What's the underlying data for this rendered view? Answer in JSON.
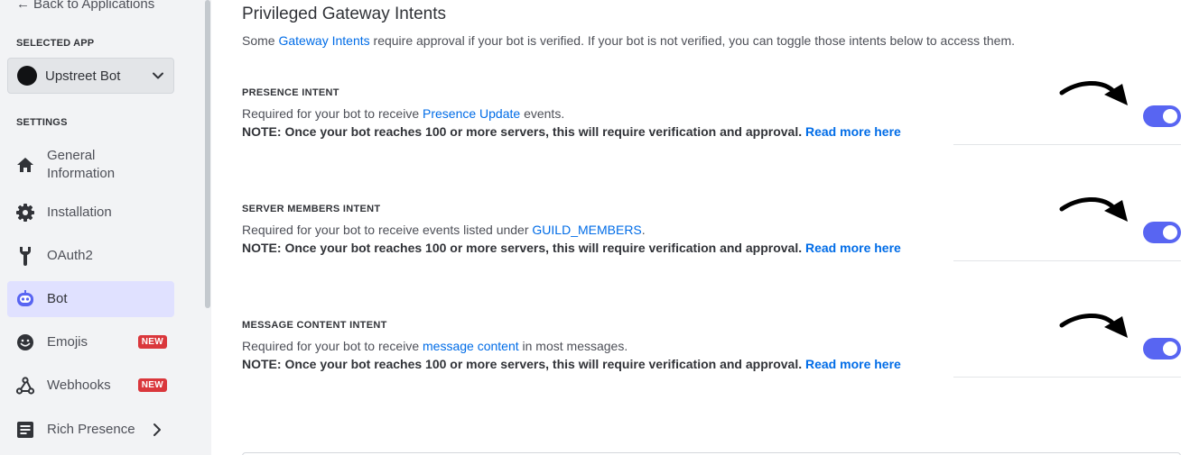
{
  "sidebar": {
    "back_label": "Back to Applications",
    "selected_app_heading": "SELECTED APP",
    "app_name": "Upstreet Bot",
    "settings_heading": "SETTINGS",
    "items": [
      {
        "label": "General Information",
        "icon": "home-icon"
      },
      {
        "label": "Installation",
        "icon": "gear-icon"
      },
      {
        "label": "OAuth2",
        "icon": "wrench-icon"
      },
      {
        "label": "Bot",
        "icon": "bot-icon",
        "active": true
      },
      {
        "label": "Emojis",
        "icon": "emoji-icon",
        "badge": "NEW"
      },
      {
        "label": "Webhooks",
        "icon": "webhook-icon",
        "badge": "NEW"
      },
      {
        "label": "Rich Presence",
        "icon": "document-icon"
      }
    ]
  },
  "main": {
    "title": "Privileged Gateway Intents",
    "desc_prefix": "Some ",
    "desc_link": "Gateway Intents",
    "desc_suffix": " require approval if your bot is verified. If your bot is not verified, you can toggle those intents below to access them.",
    "intents": [
      {
        "title": "PRESENCE INTENT",
        "desc_prefix": "Required for your bot to receive ",
        "desc_link": "Presence Update",
        "desc_suffix": " events.",
        "note": "NOTE: Once your bot reaches 100 or more servers, this will require verification and approval.",
        "note_link": "Read more here",
        "enabled": true
      },
      {
        "title": "SERVER MEMBERS INTENT",
        "desc_prefix": "Required for your bot to receive events listed under ",
        "desc_link": "GUILD_MEMBERS",
        "desc_suffix": ".",
        "note": "NOTE: Once your bot reaches 100 or more servers, this will require verification and approval.",
        "note_link": "Read more here",
        "enabled": true
      },
      {
        "title": "MESSAGE CONTENT INTENT",
        "desc_prefix": "Required for your bot to receive ",
        "desc_link": "message content",
        "desc_suffix": " in most messages.",
        "note": "NOTE: Once your bot reaches 100 or more servers, this will require verification and approval.",
        "note_link": "Read more here",
        "enabled": true
      }
    ]
  },
  "colors": {
    "accent": "#5865f2",
    "link": "#006ce7",
    "badge": "#da373c",
    "active_nav": "#e0e1ff"
  }
}
